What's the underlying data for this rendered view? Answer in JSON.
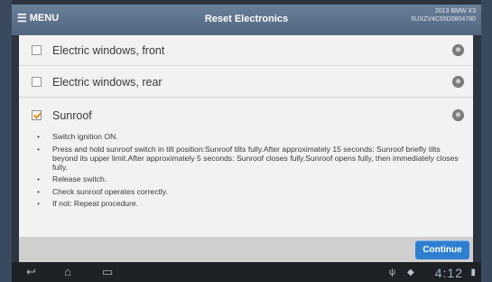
{
  "header": {
    "menu_label": "MENU",
    "title": "Reset Electronics",
    "model_year": "2013 BMW X3",
    "vin": "5UXZV4C55D0804780"
  },
  "options": [
    {
      "label": "Electric windows, front",
      "checked": false
    },
    {
      "label": "Electric windows, rear",
      "checked": false
    },
    {
      "label": "Sunroof",
      "checked": true
    }
  ],
  "procedure": [
    "Switch ignition ON.",
    "Press and hold sunroof switch in tilt position:Sunroof tilts fully.After approximately 15 seconds: Sunroof briefly tilts beyond its upper limit.After approximately 5 seconds: Sunroof closes fully.Sunroof opens fully, then immediately closes fully.",
    "Release switch.",
    "Check sunroof operates correctly.",
    "If not: Repeat procedure."
  ],
  "footer": {
    "continue_label": "Continue"
  },
  "android_nav": {
    "clock": "4:12",
    "icons": [
      "back-icon",
      "home-icon",
      "recent-apps-icon",
      "usb-icon",
      "android-debug-icon",
      "battery-icon"
    ]
  },
  "colors": {
    "header_bg": "#5e738c",
    "accent_button": "#2f7fd0",
    "check_mark": "#e08e1a"
  }
}
